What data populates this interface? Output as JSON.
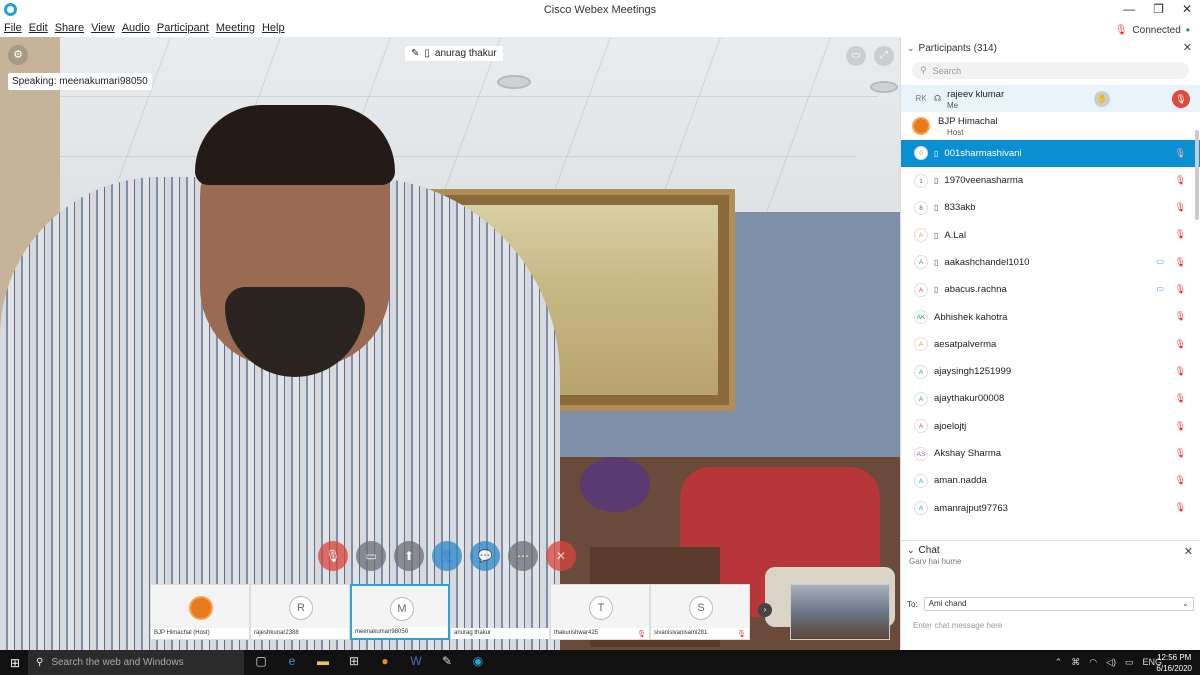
{
  "window": {
    "title": "Cisco Webex Meetings",
    "minimize_icon": "—",
    "restore_icon": "❐",
    "close_icon": "✕"
  },
  "menubar": {
    "items": [
      "File",
      "Edit",
      "Share",
      "View",
      "Audio",
      "Participant",
      "Meeting",
      "Help"
    ],
    "status": "Connected",
    "status_icon": "mic-muted-icon",
    "more": "•"
  },
  "video": {
    "speaking_label": "Speaking: meenakumari98050",
    "active_name": "anurag thakur",
    "controls": [
      "mute-mic",
      "stop-video",
      "share",
      "participants",
      "chat",
      "more",
      "leave"
    ]
  },
  "strip": {
    "thumbs": [
      {
        "name": "BJP Himachal (Host)",
        "initial": "",
        "logo": true,
        "muted": false,
        "active": false
      },
      {
        "name": "rajeshkunar2388",
        "initial": "R",
        "logo": false,
        "muted": false,
        "active": false
      },
      {
        "name": "meenakumari98050",
        "initial": "M",
        "logo": false,
        "muted": false,
        "active": true
      },
      {
        "name": "anurag thakur",
        "initial": "",
        "logo": false,
        "muted": false,
        "active": false,
        "empty": true
      },
      {
        "name": "thakurishwar425",
        "initial": "T",
        "logo": false,
        "muted": true,
        "active": false
      },
      {
        "name": "sivanisivanisami281",
        "initial": "S",
        "logo": false,
        "muted": true,
        "active": false
      }
    ],
    "next_icon": "›"
  },
  "participants": {
    "header": "Participants (314)",
    "search_placeholder": "Search",
    "rows": [
      {
        "initials": "RK",
        "name": "rajeev klumar",
        "sub": "Me",
        "type": "me"
      },
      {
        "initials": "",
        "name": "BJP Himachal",
        "sub": "Host",
        "type": "host"
      },
      {
        "initials": "0",
        "name": "001sharmashivani",
        "type": "selected",
        "mic": true
      },
      {
        "initials": "1",
        "name": "1970veenasharma",
        "mic": true
      },
      {
        "initials": "8",
        "name": "833akb",
        "mic": true
      },
      {
        "initials": "A",
        "name": "A.Lal",
        "mic": true
      },
      {
        "initials": "A",
        "name": "aakashchandel1010",
        "mic": true,
        "video": true
      },
      {
        "initials": "A",
        "name": "abacus.rachna",
        "mic": true,
        "video": true
      },
      {
        "initials": "AK",
        "name": "Abhishek kahotra",
        "mic": true
      },
      {
        "initials": "A",
        "name": "aesatpalverma",
        "mic": true
      },
      {
        "initials": "A",
        "name": "ajaysingh1251999",
        "mic": true
      },
      {
        "initials": "A",
        "name": "ajaythakur00008",
        "mic": true
      },
      {
        "initials": "A",
        "name": "ajoelojtj",
        "mic": true
      },
      {
        "initials": "AS",
        "name": "Akshay Sharma",
        "mic": true
      },
      {
        "initials": "A",
        "name": "aman.nadda",
        "mic": true
      },
      {
        "initials": "A",
        "name": "amanrajput97763",
        "mic": true
      }
    ]
  },
  "chat": {
    "header": "Chat",
    "last_message": "Garv hai hume",
    "to_label": "To:",
    "to_value": "Ami chand",
    "input_placeholder": "Enter chat message here"
  },
  "taskbar": {
    "search_placeholder": "Search the web and Windows",
    "language": "ENG",
    "time": "12:56 PM",
    "date": "6/16/2020"
  },
  "colors": {
    "accent": "#0a90d2",
    "muted_red": "#e33333",
    "taskbar": "#111111"
  }
}
